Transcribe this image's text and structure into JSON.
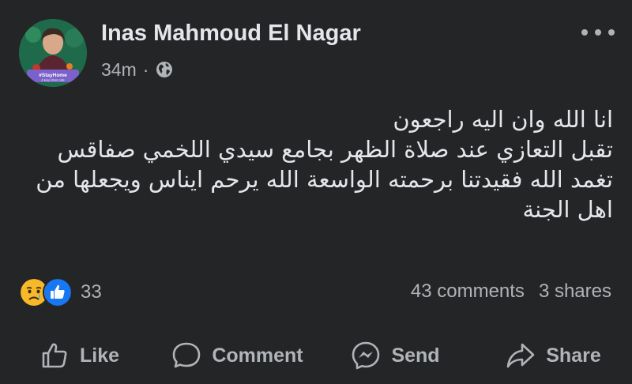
{
  "post": {
    "author": "Inas Mahmoud El Nagar",
    "time": "34m",
    "separator": "·",
    "privacy_icon": "globe-icon",
    "avatar_badge": "#StayHome",
    "avatar_badge_sub": "& keep others safe",
    "text_lines": [
      "انا الله وان اليه راجعون",
      "تقبل التعازي عند صلاة الظهر بجامع سيدي اللخمي صفاقس",
      "تغمد الله فقيدتنا برحمته الواسعة الله يرحم ايناس ويجعلها من",
      "اهل الجنة"
    ]
  },
  "reactions": {
    "icons": [
      "sad-reaction-icon",
      "like-reaction-icon"
    ],
    "count": "33"
  },
  "stats": {
    "comments": "43 comments",
    "shares": "3 shares"
  },
  "actions": {
    "like": "Like",
    "comment": "Comment",
    "send": "Send",
    "share": "Share"
  },
  "colors": {
    "background": "#242526",
    "primary_text": "#e4e6eb",
    "secondary_text": "#b0b3b8",
    "like_blue": "#1877f2",
    "sad_yellow": "#f7b928"
  }
}
